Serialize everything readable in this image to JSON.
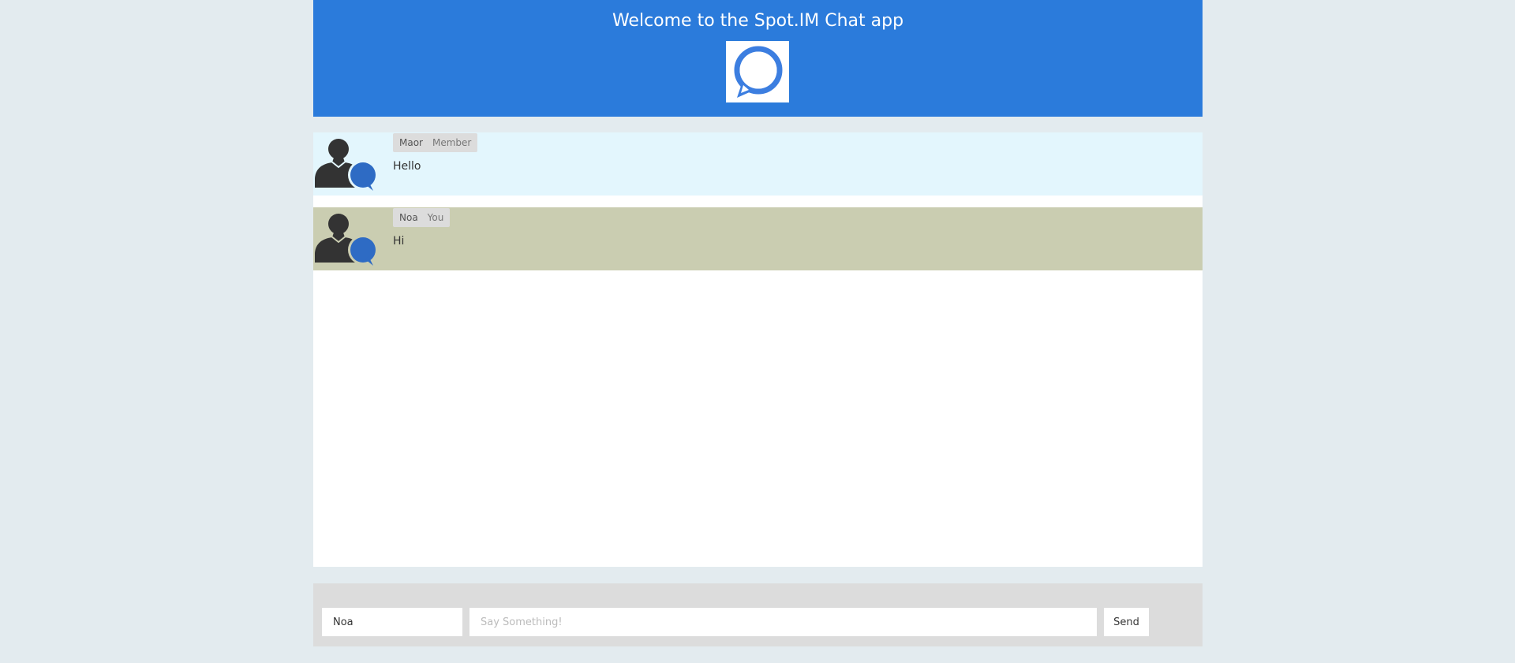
{
  "header": {
    "title": "Welcome to the Spot.IM Chat app",
    "logo_icon": "chat-bubble-icon"
  },
  "messages": [
    {
      "name": "Maor",
      "role": "Member",
      "text": "Hello",
      "avatar_icon": "user-chat-icon",
      "background": "#e3f6fd"
    },
    {
      "name": "Noa",
      "role": "You",
      "text": "Hi",
      "avatar_icon": "user-chat-icon",
      "background": "#cacdb1"
    }
  ],
  "composer": {
    "name_value": "Noa",
    "message_placeholder": "Say Something!",
    "send_label": "Send"
  },
  "colors": {
    "header_bg": "#2b7bdb",
    "page_bg": "#e3ebef",
    "bubble_blue": "#2e6bc4"
  }
}
